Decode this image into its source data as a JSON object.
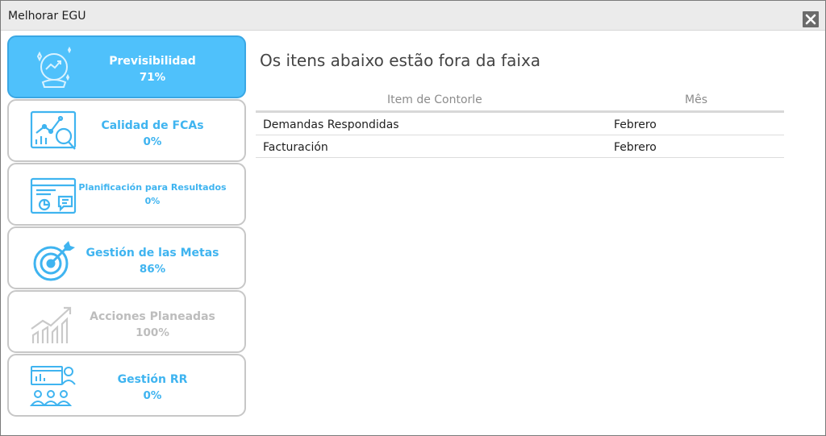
{
  "window": {
    "title": "Melhorar EGU"
  },
  "sidebar": {
    "items": [
      {
        "label": "Previsibilidad",
        "value": "71%",
        "icon": "crystal-ball-icon",
        "state": "active"
      },
      {
        "label": "Calidad de FCAs",
        "value": "0%",
        "icon": "chart-magnifier-icon",
        "state": "normal"
      },
      {
        "label": "Planificación para Resultados",
        "value": "0%",
        "icon": "presentation-board-icon",
        "state": "normal"
      },
      {
        "label": "Gestión de las Metas",
        "value": "86%",
        "icon": "target-arrow-icon",
        "state": "normal"
      },
      {
        "label": "Acciones Planeadas",
        "value": "100%",
        "icon": "growth-bars-icon",
        "state": "disabled"
      },
      {
        "label": "Gestión RR",
        "value": "0%",
        "icon": "people-dashboard-icon",
        "state": "normal"
      }
    ]
  },
  "main": {
    "title": "Os itens abaixo estão fora da faixa",
    "table": {
      "columns": [
        "Item de Contorle",
        "Mês"
      ],
      "rows": [
        [
          "Demandas Respondidas",
          "Febrero"
        ],
        [
          "Facturación",
          "Febrero"
        ]
      ]
    }
  },
  "colors": {
    "accent": "#4fc1fb",
    "accent_text": "#3fb4f0",
    "disabled_text": "#bdbdbd",
    "titlebar": "#ebebeb"
  }
}
